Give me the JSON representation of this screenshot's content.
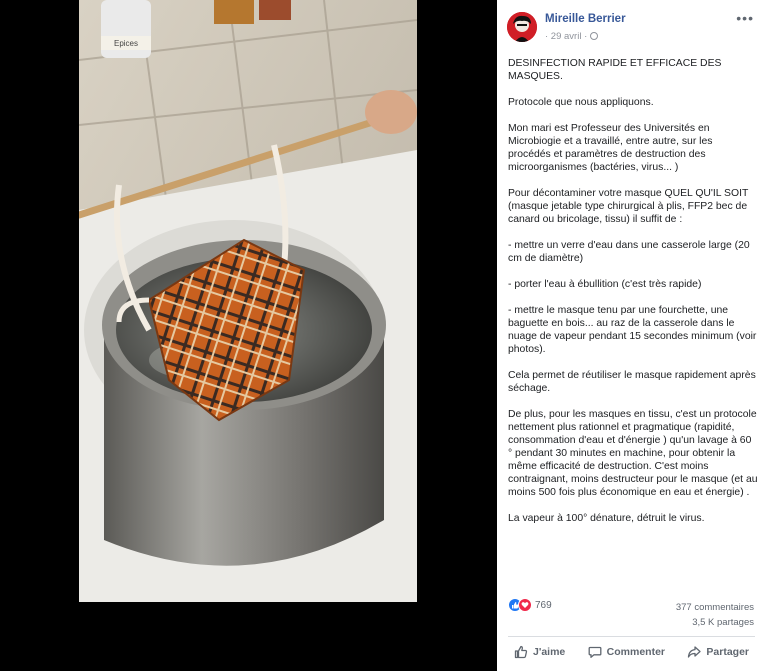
{
  "post": {
    "author": "Mireille Berrier",
    "date": "· 29 avril ·",
    "more_label": "•••",
    "paragraphs": [
      "DESINFECTION RAPIDE ET EFFICACE DES MASQUES.",
      "Protocole que nous appliquons.",
      "Mon mari est Professeur des Universités en Microbiogie et a travaillé, entre autre, sur les procédés et paramètres de destruction des microorganismes (bactéries, virus... )",
      "Pour décontaminer votre masque QUEL QU'IL SOIT (masque jetable type chirurgical à plis, FFP2 bec de canard ou bricolage, tissu) il suffit de :",
      "- mettre un verre d'eau dans une casserole large (20 cm de diamètre)",
      "- porter l'eau à ébullition (c'est très rapide)",
      "- mettre le masque tenu par une fourchette, une baguette en bois... au raz de la casserole dans le nuage de vapeur pendant 15 secondes minimum (voir photos).",
      "Cela permet de réutiliser le masque rapidement après séchage.",
      "De plus, pour les masques en tissu, c'est un protocole nettement plus rationnel et pragmatique (rapidité, consommation d'eau et d'énergie ) qu'un lavage à 60 ° pendant 30 minutes en machine, pour obtenir la même efficacité de destruction. C'est moins contraignant, moins destructeur pour le masque (et au moins 500 fois plus économique en eau et énergie) .",
      "La vapeur à 100° dénature, détruit le virus."
    ]
  },
  "photo": {
    "jar_label": "Epices"
  },
  "reactions": {
    "count": "769",
    "comments": "377 commentaires",
    "shares": "3,5 K partages"
  },
  "actions": {
    "like": "J'aime",
    "comment": "Commenter",
    "share": "Partager"
  },
  "colors": {
    "author_link": "#385898",
    "like_blue": "#2078f4",
    "love_red": "#f0284a",
    "mask_orange": "#c8601f"
  }
}
